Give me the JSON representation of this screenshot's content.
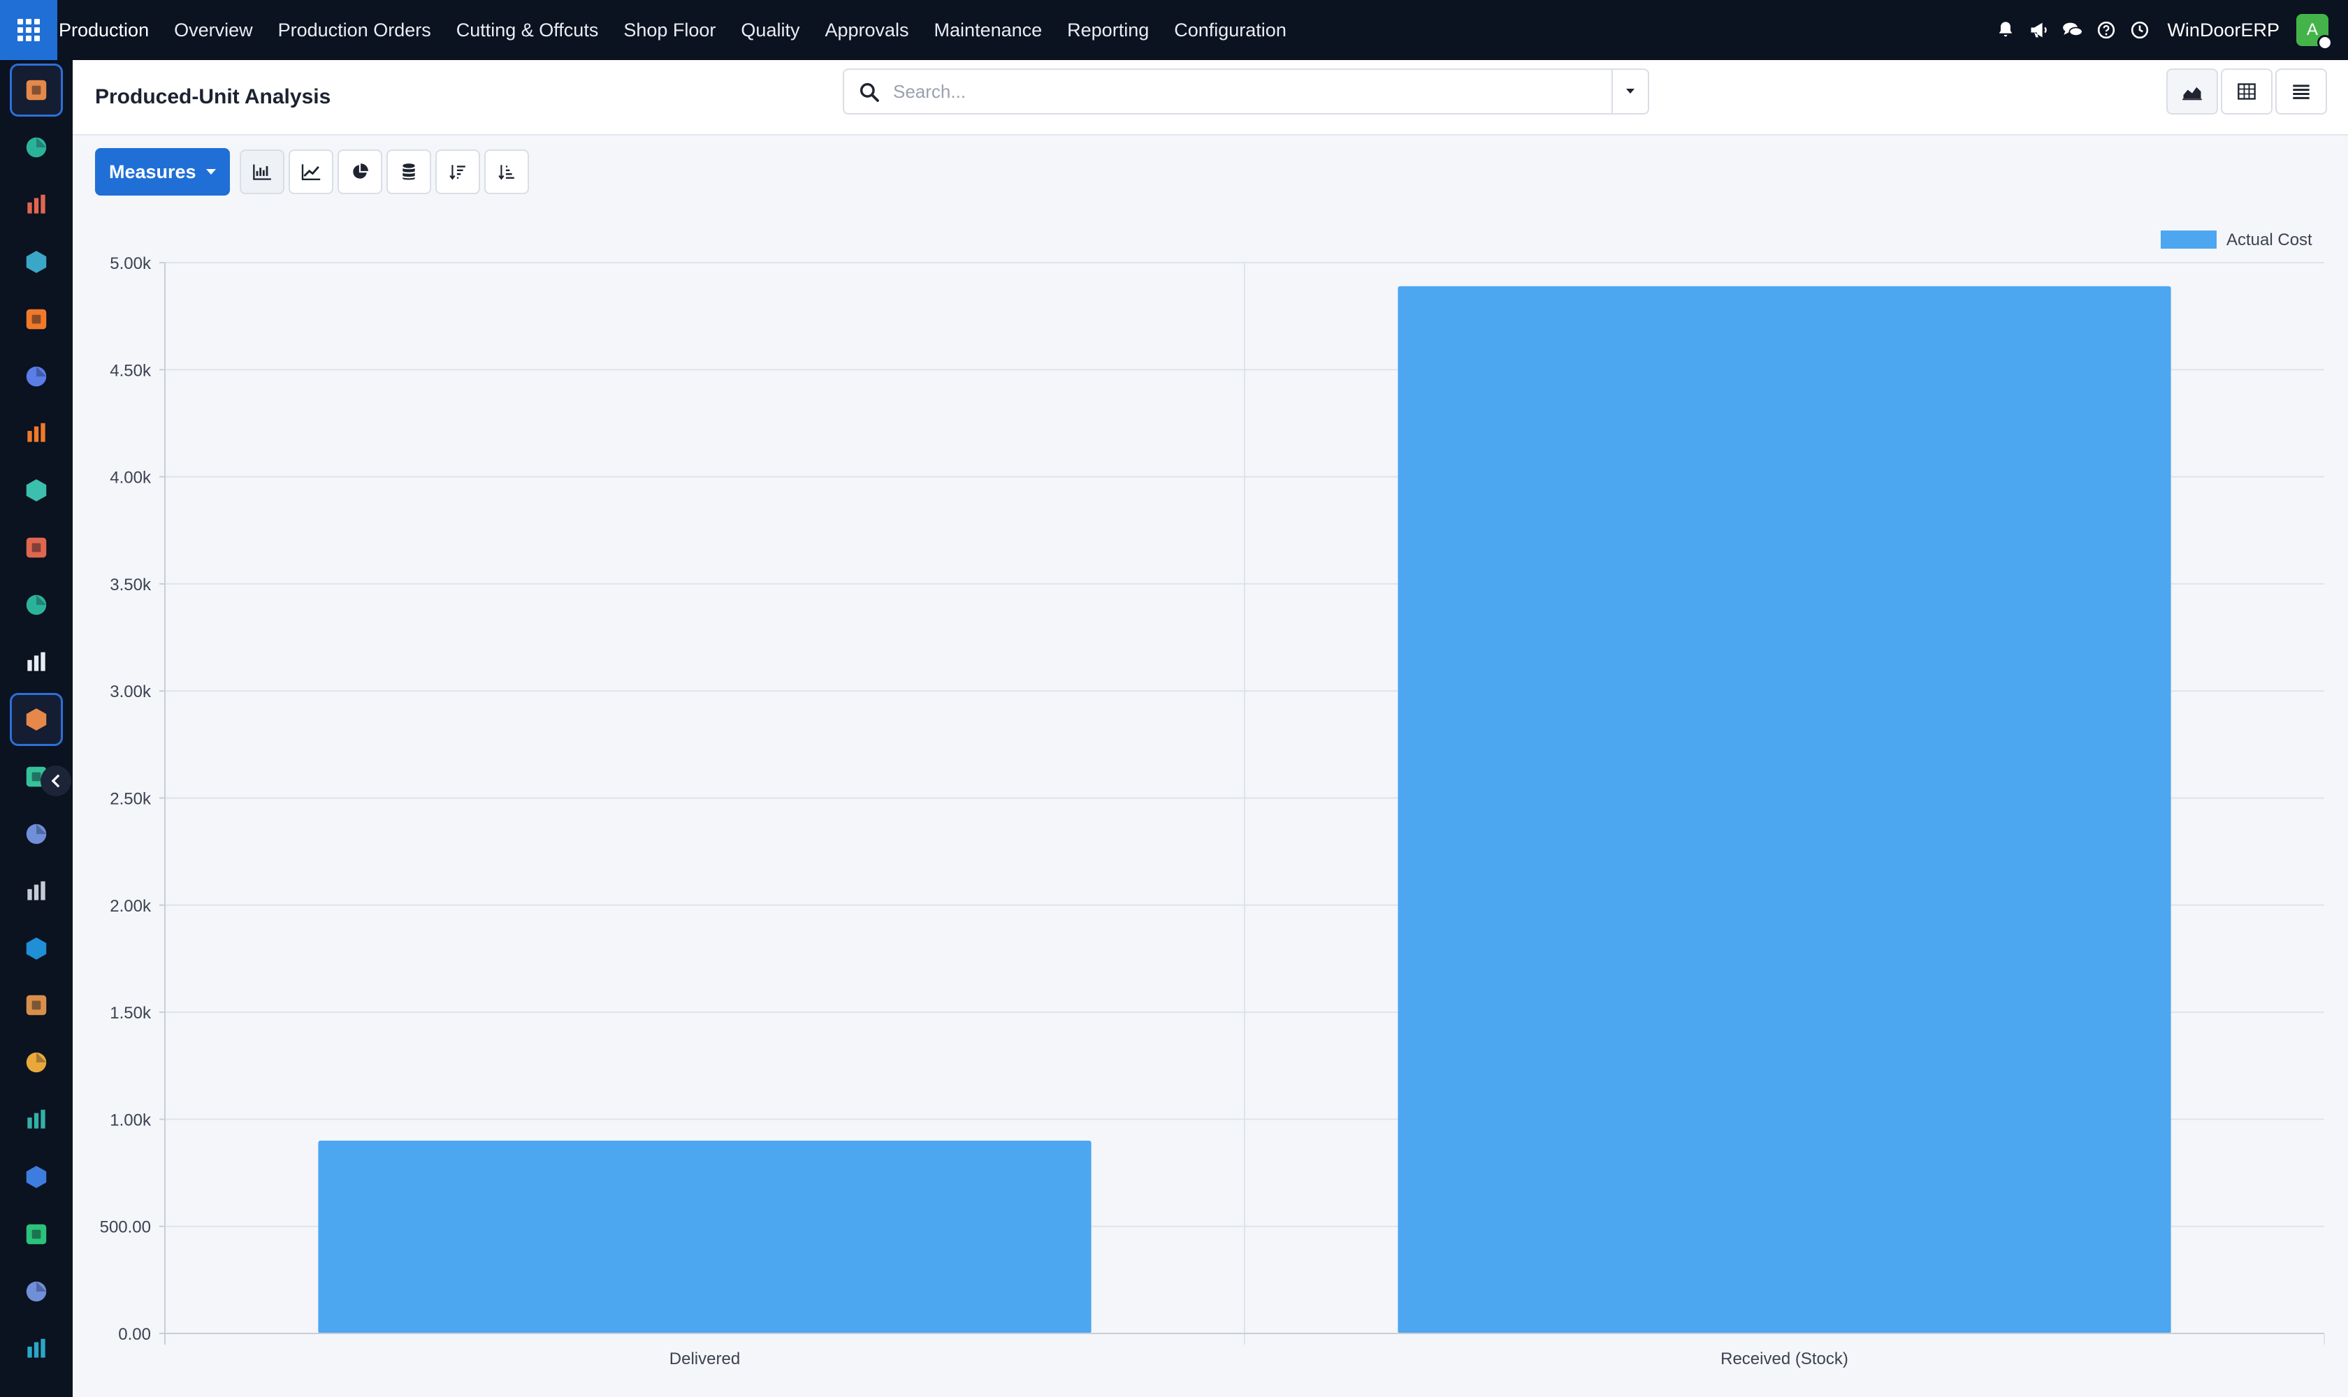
{
  "topbar": {
    "app_name": "Production",
    "menu": [
      "Overview",
      "Production Orders",
      "Cutting & Offcuts",
      "Shop Floor",
      "Quality",
      "Approvals",
      "Maintenance",
      "Reporting",
      "Configuration"
    ],
    "company": "WinDoorERP",
    "avatar_initial": "A",
    "icons": [
      "bell-icon",
      "megaphone-icon",
      "chat-icon",
      "help-icon",
      "clock-icon"
    ]
  },
  "sidebar": {
    "apps": [
      {
        "icon": "production-app-icon",
        "color": "#e6884a"
      },
      {
        "icon": "contacts-app-icon",
        "color": "#2bb39a"
      },
      {
        "icon": "sales-app-icon",
        "color": "#e0674f"
      },
      {
        "icon": "dashboard-app-icon",
        "color": "#3aa7c9"
      },
      {
        "icon": "discuss-app-icon",
        "color": "#f07a2a"
      },
      {
        "icon": "mail-app-icon",
        "color": "#5a7de6"
      },
      {
        "icon": "chat-app-icon",
        "color": "#f07a2a"
      },
      {
        "icon": "inventory-app-icon",
        "color": "#3dbfae"
      },
      {
        "icon": "reporting-app-icon",
        "color": "#e0674f"
      },
      {
        "icon": "employees-app-icon",
        "color": "#2bb39a"
      },
      {
        "icon": "product-app-icon",
        "color": "#e8edf4"
      },
      {
        "icon": "manufacturing-app-icon",
        "color": "#e6884a"
      },
      {
        "icon": "quality-app-icon",
        "color": "#35c29a"
      },
      {
        "icon": "knowledge-app-icon",
        "color": "#6f8fd8"
      },
      {
        "icon": "packaging-app-icon",
        "color": "#c7cbd6"
      },
      {
        "icon": "invoicing-app-icon",
        "color": "#1f8fd6"
      },
      {
        "icon": "team-app-icon",
        "color": "#d98f4a"
      },
      {
        "icon": "calendar-app-icon",
        "color": "#e8a83a"
      },
      {
        "icon": "sign-app-icon",
        "color": "#35b0a5"
      },
      {
        "icon": "widgets-app-icon",
        "color": "#3e7de0"
      },
      {
        "icon": "whatsapp-app-icon",
        "color": "#2bc27a"
      },
      {
        "icon": "timer-app-icon",
        "color": "#6f8fd8"
      },
      {
        "icon": "website-app-icon",
        "color": "#2aa7c7"
      }
    ],
    "active_index": 11
  },
  "control_panel": {
    "title": "Produced-Unit Analysis",
    "search_placeholder": "Search...",
    "measures_label": "Measures"
  },
  "colors": {
    "accent": "#1f6fd6",
    "bar": "#4da6f0",
    "navbar": "#0b1220"
  },
  "chart_data": {
    "type": "bar",
    "categories": [
      "Delivered",
      "Received (Stock)"
    ],
    "series": [
      {
        "name": "Actual Cost",
        "values": [
          900,
          4890
        ]
      }
    ],
    "ylim": [
      0,
      5000
    ],
    "yticks": [
      "0.00",
      "500.00",
      "1.00k",
      "1.50k",
      "2.00k",
      "2.50k",
      "3.00k",
      "3.50k",
      "4.00k",
      "4.50k",
      "5.00k"
    ],
    "grid": true,
    "legend_position": "top-right"
  }
}
